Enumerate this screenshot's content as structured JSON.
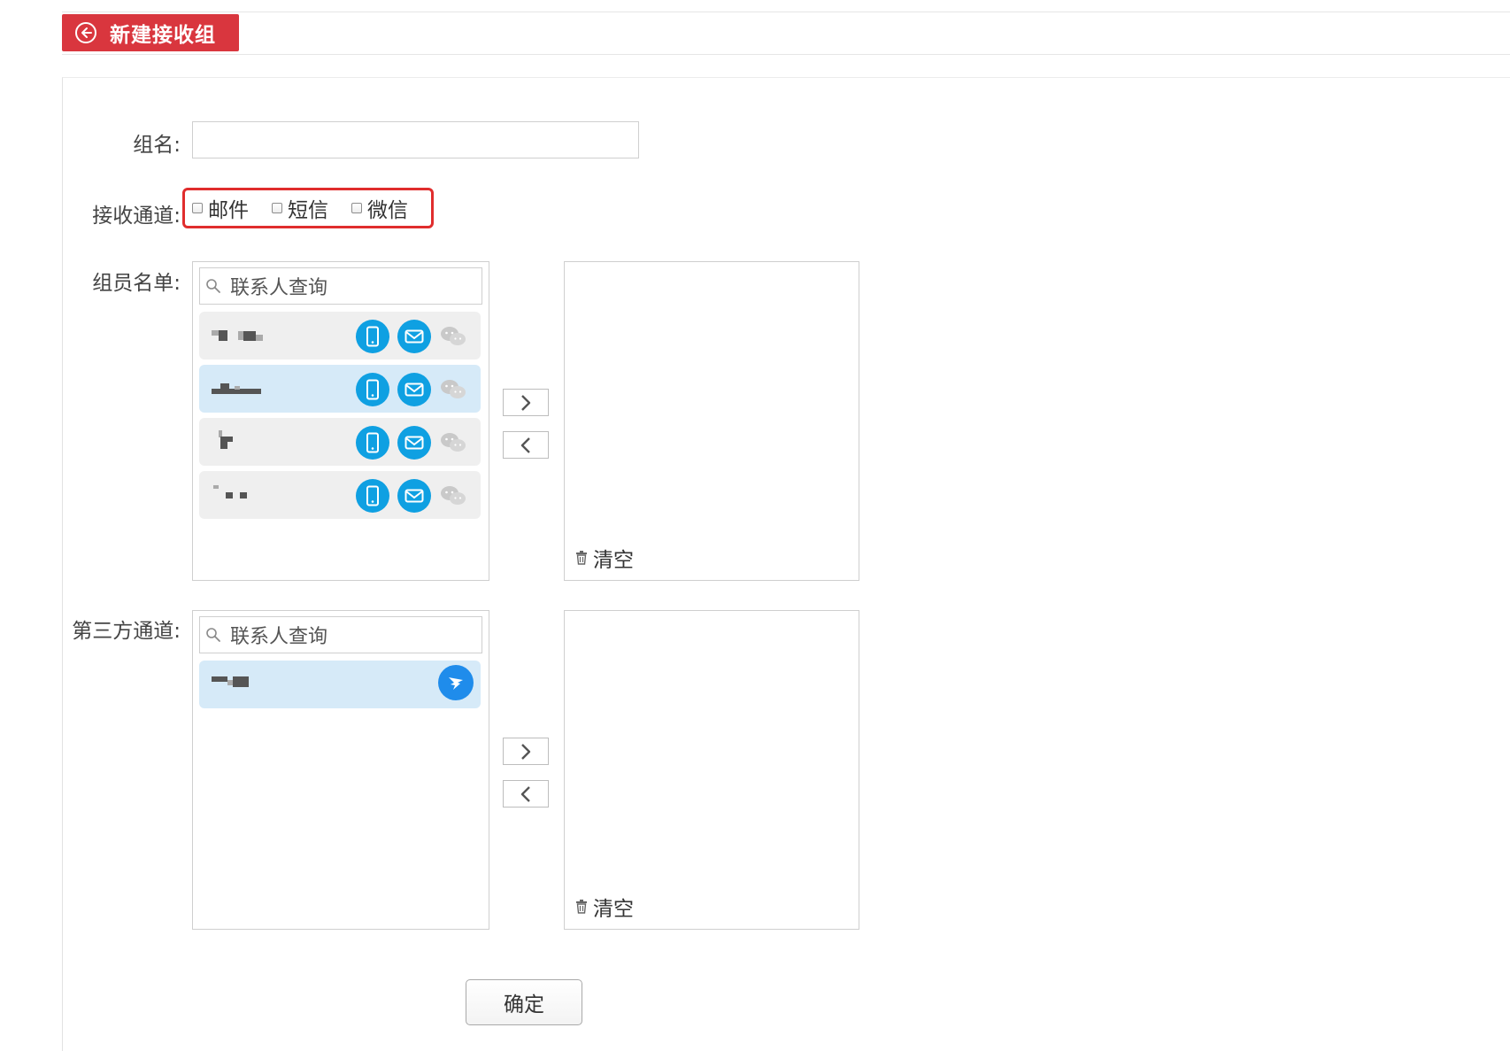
{
  "header": {
    "title": "新建接收组",
    "back_icon": "circle-arrow-left-icon",
    "accent_color": "#d9363e"
  },
  "form": {
    "group_name_label": "组名:",
    "group_name_value": "",
    "channels_label": "接收通道:",
    "channels": [
      {
        "label": "邮件",
        "checked": false
      },
      {
        "label": "短信",
        "checked": false
      },
      {
        "label": "微信",
        "checked": false
      }
    ],
    "members_label": "组员名单:",
    "members_search_placeholder": "联系人查询",
    "members": [
      {
        "selected": false,
        "icons": [
          "phone-icon",
          "mail-icon",
          "wechat-icon"
        ]
      },
      {
        "selected": true,
        "icons": [
          "phone-icon",
          "mail-icon",
          "wechat-icon"
        ]
      },
      {
        "selected": false,
        "icons": [
          "phone-icon",
          "mail-icon",
          "wechat-icon"
        ]
      },
      {
        "selected": false,
        "icons": [
          "phone-icon",
          "mail-icon",
          "wechat-icon"
        ]
      }
    ],
    "third_party_label": "第三方通道:",
    "third_party_search_placeholder": "联系人查询",
    "third_party_contacts": [
      {
        "selected": true,
        "icons": [
          "dingtalk-icon"
        ]
      }
    ],
    "clear_label": "清空",
    "confirm_label": "确定",
    "icon_color": "#0fa0e2"
  }
}
